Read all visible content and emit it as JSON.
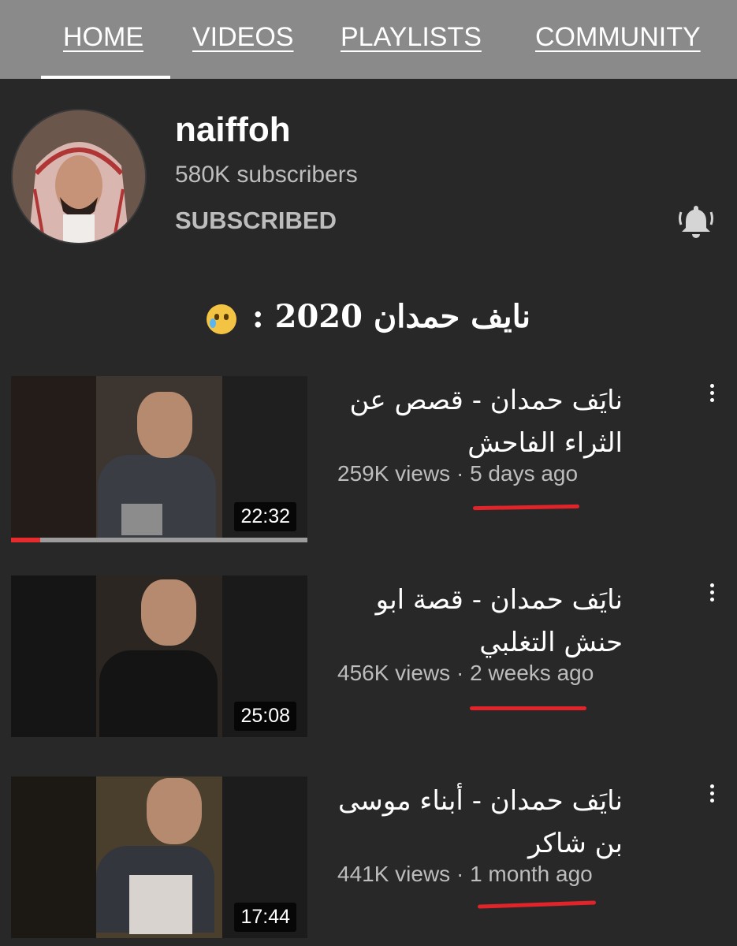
{
  "tabs": [
    {
      "label": "HOME",
      "active": true
    },
    {
      "label": "VIDEOS"
    },
    {
      "label": "PLAYLISTS"
    },
    {
      "label": "COMMUNITY"
    }
  ],
  "channel": {
    "name": "naiffoh",
    "subscribers": "580K subscribers",
    "subscribe_state": "SUBSCRIBED",
    "bell_icon": "bell-icon"
  },
  "caption": {
    "text": "نايف حمدان 2020 :",
    "emoji": "crying-face-emoji"
  },
  "videos": [
    {
      "title": "نايَف حمدان - قصص عن الثراء الفاحش",
      "views": "259K views",
      "age": "5 days ago",
      "duration": "22:32",
      "watch_progress": 0.1
    },
    {
      "title": "نايَف حمدان - قصة ابو حنش التغلبي",
      "views": "456K views",
      "age": "2 weeks ago",
      "duration": "25:08"
    },
    {
      "title": "نايَف حمدان - أبناء موسى بن شاكر",
      "views": "441K views",
      "age": "1 month ago",
      "duration": "17:44"
    }
  ],
  "colors": {
    "background": "#282828",
    "tab_bar": "#8a8a8a",
    "annotation": "#e0242a",
    "progress": "#e52b2b"
  }
}
